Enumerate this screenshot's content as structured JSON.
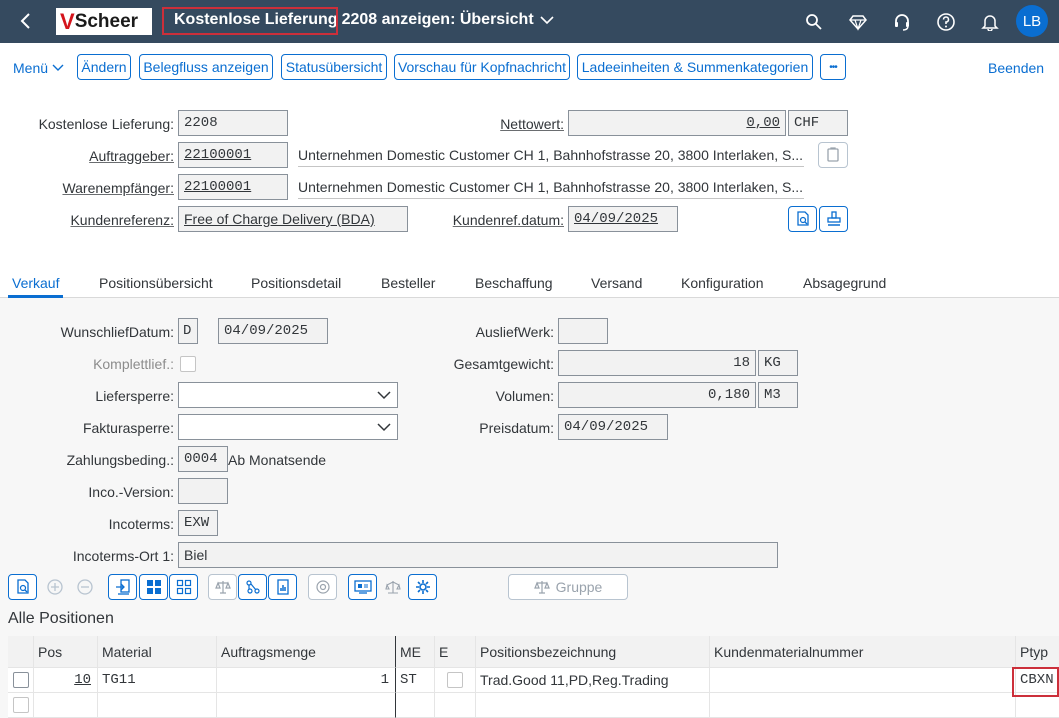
{
  "shell": {
    "logo_letter": "V",
    "logo_text": "Scheer",
    "title_part1": "Kostenlose Lieferung",
    "title_part2": "2208 anzeigen: Übersicht",
    "avatar_initials": "LB"
  },
  "toolbar": {
    "menu_label": "Menü",
    "buttons": [
      "Ändern",
      "Belegfluss anzeigen",
      "Statusübersicht",
      "Vorschau für Kopfnachricht",
      "Ladeeinheiten & Summenkategorien"
    ],
    "more_label": "•••",
    "exit_label": "Beenden"
  },
  "header": {
    "delivery_label": "Kostenlose Lieferung:",
    "delivery_value": "2208",
    "net_value_label": "Nettowert:",
    "net_value": "0,00",
    "currency": "CHF",
    "sold_to_label": "Auftraggeber:",
    "sold_to_value": "22100001",
    "sold_to_desc": "Unternehmen Domestic Customer CH 1, Bahnhofstrasse 20, 3800 Interlaken, S...",
    "ship_to_label": "Warenempfänger:",
    "ship_to_value": "22100001",
    "ship_to_desc": "Unternehmen Domestic Customer CH 1, Bahnhofstrasse 20, 3800 Interlaken, S...",
    "cust_ref_label": "Kundenreferenz:",
    "cust_ref_value": "Free of Charge Delivery (BDA)",
    "cust_ref_date_label": "Kundenref.datum:",
    "cust_ref_date_value": "04/09/2025"
  },
  "tabs": [
    "Verkauf",
    "Positionsübersicht",
    "Positionsdetail",
    "Besteller",
    "Beschaffung",
    "Versand",
    "Konfiguration",
    "Absagegrund"
  ],
  "sales": {
    "req_date_label": "WunschliefDatum:",
    "req_date_type": "D",
    "req_date_value": "04/09/2025",
    "complete_label": "Komplettlief.:",
    "delivery_block_label": "Liefersperre:",
    "billing_block_label": "Fakturasperre:",
    "payment_terms_label": "Zahlungsbeding.:",
    "payment_terms_value": "0004",
    "payment_terms_desc": "Ab Monatsende",
    "inco_version_label": "Inco.-Version:",
    "incoterms_label": "Incoterms:",
    "incoterms_value": "EXW",
    "incoterms_loc_label": "Incoterms-Ort 1:",
    "incoterms_loc_value": "Biel",
    "plant_label": "AusliefWerk:",
    "total_weight_label": "Gesamtgewicht:",
    "total_weight_value": "18",
    "weight_unit": "KG",
    "volume_label": "Volumen:",
    "volume_value": "0,180",
    "volume_unit": "M3",
    "price_date_label": "Preisdatum:",
    "price_date_value": "04/09/2025"
  },
  "items": {
    "group_button_label": "Gruppe",
    "section_title": "Alle Positionen",
    "columns": [
      "Pos",
      "Material",
      "Auftragsmenge",
      "ME",
      "E",
      "Positionsbezeichnung",
      "Kundenmaterialnummer",
      "Ptyp"
    ],
    "rows": [
      {
        "pos": "10",
        "material": "TG11",
        "qty": "1",
        "unit": "ST",
        "desc": "Trad.Good 11,PD,Reg.Trading",
        "cust_mat": "",
        "ptyp": "CBXN"
      }
    ]
  }
}
